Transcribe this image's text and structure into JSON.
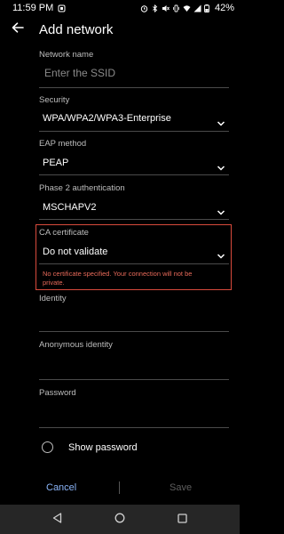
{
  "status_bar": {
    "time": "11:59 PM",
    "battery": "42%"
  },
  "header": {
    "title": "Add network"
  },
  "form": {
    "network_name": {
      "label": "Network name",
      "placeholder": "Enter the SSID"
    },
    "security": {
      "label": "Security",
      "value": "WPA/WPA2/WPA3-Enterprise"
    },
    "eap_method": {
      "label": "EAP method",
      "value": "PEAP"
    },
    "phase2": {
      "label": "Phase 2 authentication",
      "value": "MSCHAPV2"
    },
    "ca_certificate": {
      "label": "CA certificate",
      "value": "Do not validate",
      "error_line1": "No certificate specified. Your connection will not be",
      "error_line2": "private."
    },
    "identity": {
      "label": "Identity"
    },
    "anonymous_identity": {
      "label": "Anonymous identity"
    },
    "password": {
      "label": "Password"
    },
    "show_password": {
      "label": "Show password",
      "checked": false
    }
  },
  "actions": {
    "cancel": "Cancel",
    "save": "Save"
  },
  "colors": {
    "accent": "#8ab4f8",
    "error": "#d84a3c",
    "disabled": "#5f5f5f",
    "background": "#000000",
    "nav_bar": "#262626"
  },
  "icons": [
    "back-arrow-icon",
    "nav-back-icon",
    "nav-home-icon",
    "nav-recents-icon",
    "wifi-icon",
    "battery-icon",
    "bluetooth-icon",
    "alarm-icon",
    "vibrate-icon",
    "chevron-down-icon"
  ]
}
